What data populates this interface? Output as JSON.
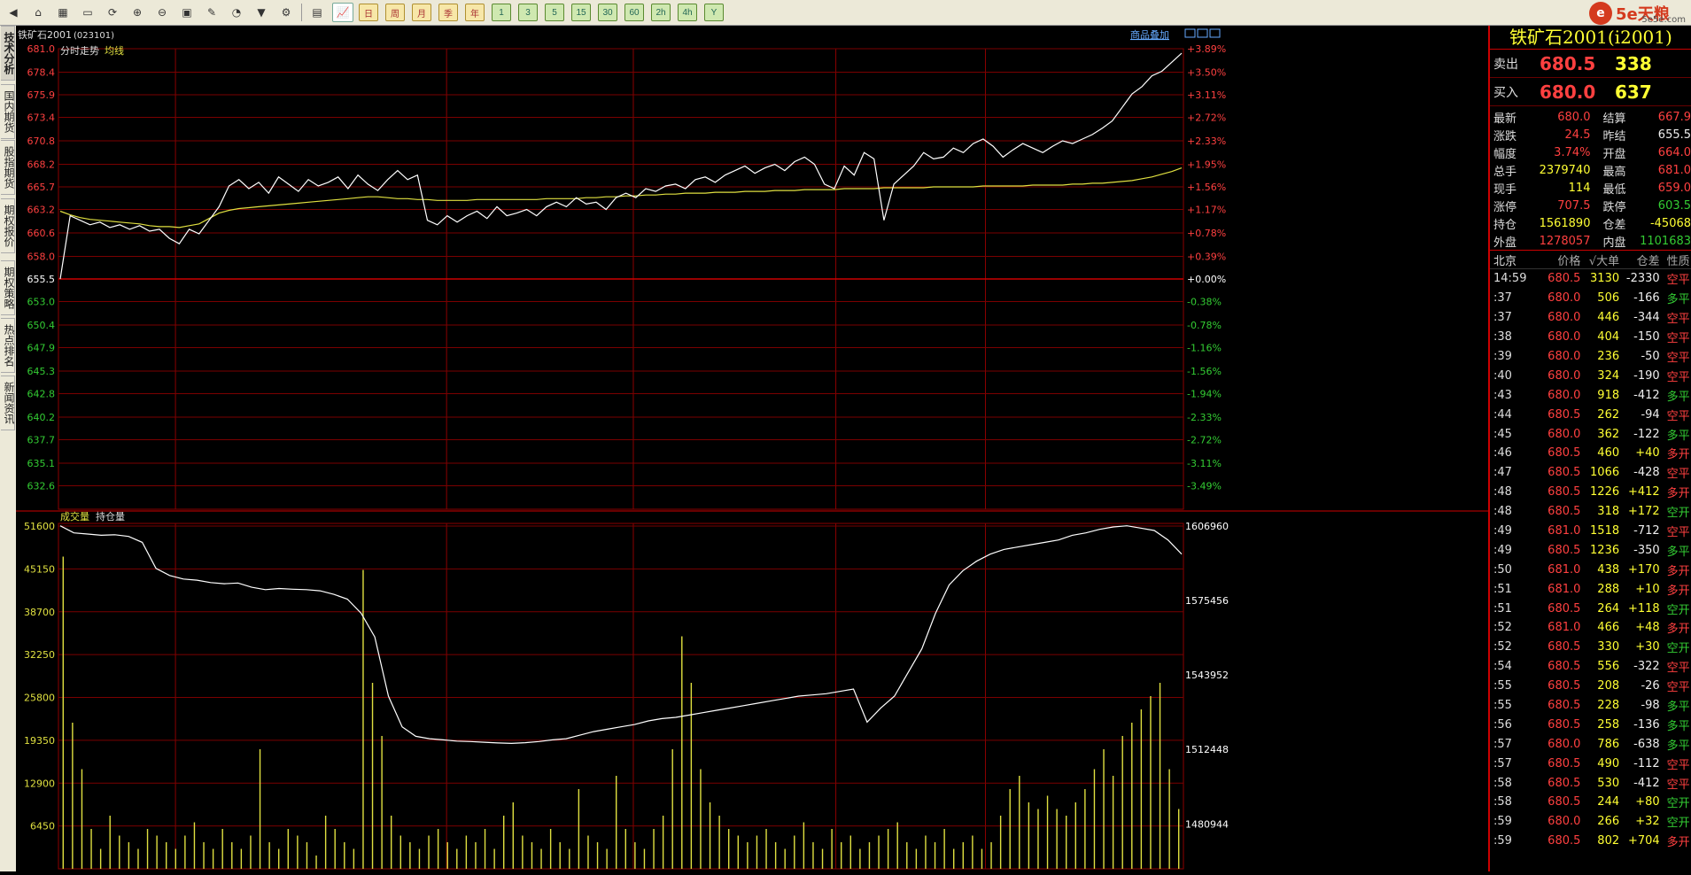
{
  "brand": {
    "logo": "e",
    "text": "5e天粮",
    "sub": "5e5e.com"
  },
  "toolbar": {
    "icons": [
      "back-icon",
      "home-icon",
      "book-icon",
      "monitor-icon",
      "refresh-icon",
      "zoom-in-icon",
      "zoom-out-icon",
      "window-icon",
      "pen-icon",
      "pie-icon",
      "filter-icon",
      "settings-icon"
    ],
    "periods": [
      "日",
      "周",
      "月",
      "季",
      "年",
      "1",
      "3",
      "5",
      "15",
      "30",
      "60",
      "2h",
      "4h",
      "Y"
    ]
  },
  "sidetabs": [
    "技术分析",
    "国内期货",
    "股指期货",
    "期权报价",
    "期权策略",
    "热点排名",
    "新闻资讯"
  ],
  "chart": {
    "instrument": "铁矿石2001",
    "code": "(023101)",
    "price_panel_label": "分时走势",
    "avg_label": "均线",
    "overlay_link": "商品叠加",
    "volume_label": "成交量",
    "oi_label": "持仓量",
    "price_ticks": [
      "681.0",
      "678.4",
      "675.9",
      "673.4",
      "670.8",
      "668.2",
      "665.7",
      "663.2",
      "660.6",
      "658.0",
      "655.5",
      "653.0",
      "650.4",
      "647.9",
      "645.3",
      "642.8",
      "640.2",
      "637.7",
      "635.1",
      "632.6"
    ],
    "pct_ticks": [
      "+3.89%",
      "+3.50%",
      "+3.11%",
      "+2.72%",
      "+2.33%",
      "+1.95%",
      "+1.56%",
      "+1.17%",
      "+0.78%",
      "+0.39%",
      "+0.00%",
      "-0.38%",
      "-0.78%",
      "-1.16%",
      "-1.56%",
      "-1.94%",
      "-2.33%",
      "-2.72%",
      "-3.11%",
      "-3.49%"
    ],
    "vol_ticks": [
      "51600",
      "45150",
      "38700",
      "32250",
      "25800",
      "19350",
      "12900",
      "6450"
    ],
    "oi_ticks": [
      "1606960",
      "1575456",
      "1543952",
      "1512448",
      "1480944"
    ]
  },
  "chart_data": {
    "type": "line",
    "prev_settle": 655.5,
    "price_range": [
      630.0,
      681.0
    ],
    "series": [
      {
        "name": "分时走势",
        "color": "#ffffff",
        "values": [
          655.5,
          662.5,
          662.0,
          661.5,
          661.8,
          661.2,
          661.5,
          661.0,
          661.4,
          660.8,
          661.0,
          660.0,
          659.4,
          661.0,
          660.5,
          662.0,
          663.5,
          665.8,
          666.5,
          665.5,
          666.2,
          665.0,
          666.8,
          666.0,
          665.2,
          666.5,
          665.8,
          666.2,
          666.8,
          665.5,
          667.0,
          666.0,
          665.3,
          666.5,
          667.5,
          666.5,
          667.0,
          662.0,
          661.5,
          662.5,
          661.8,
          662.5,
          663.0,
          662.2,
          663.5,
          662.5,
          662.8,
          663.2,
          662.5,
          663.5,
          664.0,
          663.5,
          664.5,
          663.8,
          664.0,
          663.2,
          664.5,
          665.0,
          664.5,
          665.5,
          665.2,
          665.8,
          666.0,
          665.5,
          666.5,
          666.8,
          666.2,
          667.0,
          667.5,
          668.0,
          667.2,
          667.8,
          668.2,
          667.5,
          668.5,
          669.0,
          668.2,
          666.0,
          665.5,
          668.0,
          667.0,
          669.5,
          668.8,
          662.0,
          666.0,
          667.0,
          668.0,
          669.5,
          668.8,
          669.0,
          670.0,
          669.5,
          670.5,
          671.0,
          670.2,
          669.0,
          669.8,
          670.5,
          670.0,
          669.5,
          670.2,
          670.8,
          670.5,
          671.0,
          671.5,
          672.2,
          673.0,
          674.5,
          676.0,
          676.8,
          678.0,
          678.5,
          679.5,
          680.5
        ]
      },
      {
        "name": "均线",
        "color": "#e0e040",
        "values": [
          663.0,
          662.6,
          662.3,
          662.1,
          662.0,
          661.9,
          661.8,
          661.7,
          661.6,
          661.4,
          661.3,
          661.3,
          661.2,
          661.4,
          661.6,
          662.2,
          662.8,
          663.1,
          663.3,
          663.4,
          663.5,
          663.6,
          663.7,
          663.8,
          663.9,
          664.0,
          664.1,
          664.2,
          664.3,
          664.4,
          664.5,
          664.6,
          664.6,
          664.5,
          664.4,
          664.4,
          664.3,
          664.3,
          664.2,
          664.2,
          664.2,
          664.2,
          664.3,
          664.3,
          664.3,
          664.3,
          664.3,
          664.3,
          664.3,
          664.4,
          664.4,
          664.4,
          664.4,
          664.5,
          664.5,
          664.6,
          664.6,
          664.7,
          664.7,
          664.8,
          664.8,
          664.9,
          664.9,
          665.0,
          665.0,
          665.0,
          665.1,
          665.1,
          665.1,
          665.2,
          665.2,
          665.2,
          665.3,
          665.3,
          665.3,
          665.4,
          665.4,
          665.4,
          665.4,
          665.5,
          665.5,
          665.5,
          665.5,
          665.6,
          665.6,
          665.6,
          665.6,
          665.6,
          665.7,
          665.7,
          665.7,
          665.7,
          665.7,
          665.8,
          665.8,
          665.8,
          665.8,
          665.8,
          665.9,
          665.9,
          665.9,
          665.9,
          666.0,
          666.0,
          666.1,
          666.1,
          666.2,
          666.3,
          666.4,
          666.6,
          666.8,
          667.1,
          667.4,
          667.8
        ]
      }
    ],
    "volume": {
      "range": [
        0,
        51600
      ],
      "values": [
        47000,
        22000,
        15000,
        6000,
        3000,
        8000,
        5000,
        4000,
        3000,
        6000,
        5000,
        4000,
        3000,
        5000,
        7000,
        4000,
        3000,
        6000,
        4000,
        3000,
        5000,
        18000,
        4000,
        3000,
        6000,
        5000,
        4000,
        2000,
        8000,
        6000,
        4000,
        3000,
        45000,
        28000,
        20000,
        8000,
        5000,
        4000,
        3000,
        5000,
        6000,
        4000,
        3000,
        5000,
        4000,
        6000,
        3000,
        8000,
        10000,
        5000,
        4000,
        3000,
        6000,
        4000,
        3000,
        12000,
        5000,
        4000,
        3000,
        14000,
        6000,
        4000,
        3000,
        6000,
        8000,
        18000,
        35000,
        28000,
        15000,
        10000,
        8000,
        6000,
        5000,
        4000,
        5000,
        6000,
        4000,
        3000,
        5000,
        7000,
        4000,
        3000,
        6000,
        4000,
        5000,
        3000,
        4000,
        5000,
        6000,
        7000,
        4000,
        3000,
        5000,
        4000,
        6000,
        3000,
        4000,
        5000,
        3000,
        4000,
        8000,
        12000,
        14000,
        10000,
        9000,
        11000,
        9000,
        8000,
        10000,
        12000,
        15000,
        18000,
        14000,
        20000,
        22000,
        24000,
        26000,
        28000,
        15000,
        9000
      ]
    },
    "open_interest": {
      "range": [
        1462000,
        1608000
      ],
      "values": [
        1607000,
        1604000,
        1603500,
        1603000,
        1603200,
        1602500,
        1600000,
        1589000,
        1586000,
        1584500,
        1584000,
        1583000,
        1582500,
        1582800,
        1581000,
        1580000,
        1580500,
        1580200,
        1580000,
        1579500,
        1578000,
        1576000,
        1570000,
        1560000,
        1535000,
        1522000,
        1518000,
        1517000,
        1516500,
        1516000,
        1515800,
        1515500,
        1515200,
        1515000,
        1515300,
        1515800,
        1516500,
        1517000,
        1518500,
        1520000,
        1521000,
        1522000,
        1523000,
        1524500,
        1525500,
        1526000,
        1527000,
        1528000,
        1529000,
        1530000,
        1531000,
        1532000,
        1533000,
        1534000,
        1535000,
        1535500,
        1536000,
        1537000,
        1538000,
        1524000,
        1530000,
        1535000,
        1545000,
        1555000,
        1570000,
        1582000,
        1588000,
        1592000,
        1595000,
        1597000,
        1598000,
        1599000,
        1600000,
        1601000,
        1603000,
        1604000,
        1605500,
        1606500,
        1607000,
        1606000,
        1605000,
        1601000,
        1595000
      ]
    }
  },
  "panel": {
    "title": "铁矿石2001(i2001)",
    "sell": {
      "label": "卖出",
      "price": "680.5",
      "vol": "338"
    },
    "buy": {
      "label": "买入",
      "price": "680.0",
      "vol": "637"
    },
    "stats": [
      {
        "l": "最新",
        "v": "680.0",
        "vc": "red",
        "l2": "结算",
        "v2": "667.9",
        "v2c": "red"
      },
      {
        "l": "涨跌",
        "v": "24.5",
        "vc": "red",
        "l2": "昨结",
        "v2": "655.5",
        "v2c": "white"
      },
      {
        "l": "幅度",
        "v": "3.74%",
        "vc": "red",
        "l2": "开盘",
        "v2": "664.0",
        "v2c": "red"
      },
      {
        "l": "总手",
        "v": "2379740",
        "vc": "yellow",
        "l2": "最高",
        "v2": "681.0",
        "v2c": "red"
      },
      {
        "l": "现手",
        "v": "114",
        "vc": "yellow",
        "l2": "最低",
        "v2": "659.0",
        "v2c": "red"
      },
      {
        "l": "涨停",
        "v": "707.5",
        "vc": "red",
        "l2": "跌停",
        "v2": "603.5",
        "v2c": "green"
      },
      {
        "l": "持仓",
        "v": "1561890",
        "vc": "yellow",
        "l2": "仓差",
        "v2": "-45068",
        "v2c": "yellow"
      },
      {
        "l": "外盘",
        "v": "1278057",
        "vc": "red",
        "l2": "内盘",
        "v2": "1101683",
        "v2c": "green"
      }
    ],
    "table_header": {
      "t": "北京",
      "p": "价格",
      "v": "√大单",
      "o": "仓差",
      "n": "性质"
    },
    "ticks": [
      {
        "t": "14:59",
        "p": "680.5",
        "v": "3130",
        "o": "-2330",
        "n": "空平"
      },
      {
        "t": ":37",
        "p": "680.0",
        "v": "506",
        "o": "-166",
        "n": "多平"
      },
      {
        "t": ":37",
        "p": "680.0",
        "v": "446",
        "o": "-344",
        "n": "空平"
      },
      {
        "t": ":38",
        "p": "680.0",
        "v": "404",
        "o": "-150",
        "n": "空平"
      },
      {
        "t": ":39",
        "p": "680.0",
        "v": "236",
        "o": "-50",
        "n": "空平"
      },
      {
        "t": ":40",
        "p": "680.0",
        "v": "324",
        "o": "-190",
        "n": "空平"
      },
      {
        "t": ":43",
        "p": "680.0",
        "v": "918",
        "o": "-412",
        "n": "多平"
      },
      {
        "t": ":44",
        "p": "680.5",
        "v": "262",
        "o": "-94",
        "n": "空平"
      },
      {
        "t": ":45",
        "p": "680.0",
        "v": "362",
        "o": "-122",
        "n": "多平"
      },
      {
        "t": ":46",
        "p": "680.5",
        "v": "460",
        "o": "+40",
        "n": "多开"
      },
      {
        "t": ":47",
        "p": "680.5",
        "v": "1066",
        "o": "-428",
        "n": "空平"
      },
      {
        "t": ":48",
        "p": "680.5",
        "v": "1226",
        "o": "+412",
        "n": "多开"
      },
      {
        "t": ":48",
        "p": "680.5",
        "v": "318",
        "o": "+172",
        "n": "空开"
      },
      {
        "t": ":49",
        "p": "681.0",
        "v": "1518",
        "o": "-712",
        "n": "空平"
      },
      {
        "t": ":49",
        "p": "680.5",
        "v": "1236",
        "o": "-350",
        "n": "多平"
      },
      {
        "t": ":50",
        "p": "681.0",
        "v": "438",
        "o": "+170",
        "n": "多开"
      },
      {
        "t": ":51",
        "p": "681.0",
        "v": "288",
        "o": "+10",
        "n": "多开"
      },
      {
        "t": ":51",
        "p": "680.5",
        "v": "264",
        "o": "+118",
        "n": "空开"
      },
      {
        "t": ":52",
        "p": "681.0",
        "v": "466",
        "o": "+48",
        "n": "多开"
      },
      {
        "t": ":52",
        "p": "680.5",
        "v": "330",
        "o": "+30",
        "n": "空开"
      },
      {
        "t": ":54",
        "p": "680.5",
        "v": "556",
        "o": "-322",
        "n": "空平"
      },
      {
        "t": ":55",
        "p": "680.5",
        "v": "208",
        "o": "-26",
        "n": "空平"
      },
      {
        "t": ":55",
        "p": "680.5",
        "v": "228",
        "o": "-98",
        "n": "多平"
      },
      {
        "t": ":56",
        "p": "680.5",
        "v": "258",
        "o": "-136",
        "n": "多平"
      },
      {
        "t": ":57",
        "p": "680.0",
        "v": "786",
        "o": "-638",
        "n": "多平"
      },
      {
        "t": ":57",
        "p": "680.5",
        "v": "490",
        "o": "-112",
        "n": "空平"
      },
      {
        "t": ":58",
        "p": "680.5",
        "v": "530",
        "o": "-412",
        "n": "空平"
      },
      {
        "t": ":58",
        "p": "680.5",
        "v": "244",
        "o": "+80",
        "n": "空开"
      },
      {
        "t": ":59",
        "p": "680.0",
        "v": "266",
        "o": "+32",
        "n": "空开"
      },
      {
        "t": ":59",
        "p": "680.5",
        "v": "802",
        "o": "+704",
        "n": "多开"
      }
    ]
  }
}
